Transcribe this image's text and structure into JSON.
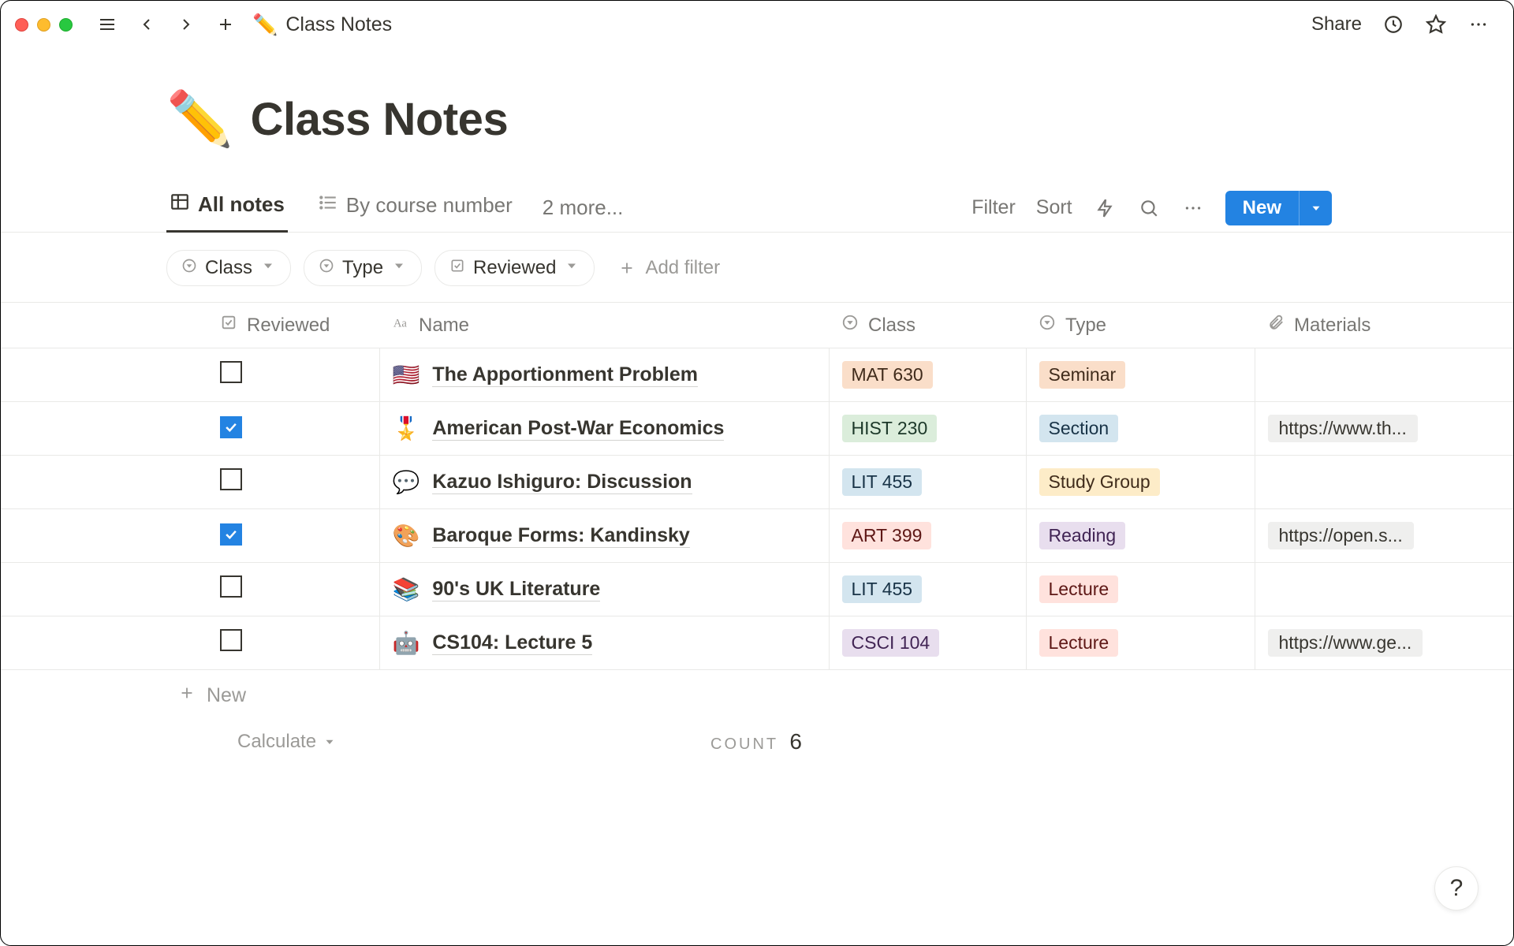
{
  "breadcrumb": {
    "emoji": "✏️",
    "title": "Class Notes"
  },
  "topbar": {
    "share_label": "Share"
  },
  "page": {
    "emoji": "✏️",
    "title": "Class Notes"
  },
  "views": {
    "tabs": [
      {
        "icon": "table",
        "label": "All notes",
        "active": true
      },
      {
        "icon": "list",
        "label": "By course number",
        "active": false
      }
    ],
    "more_label": "2 more...",
    "filter_label": "Filter",
    "sort_label": "Sort",
    "new_label": "New"
  },
  "filters": {
    "chips": [
      {
        "icon": "multiselect",
        "label": "Class"
      },
      {
        "icon": "multiselect",
        "label": "Type"
      },
      {
        "icon": "checkbox",
        "label": "Reviewed"
      }
    ],
    "add_label": "Add filter"
  },
  "columns": [
    {
      "icon": "checkbox",
      "label": "Reviewed"
    },
    {
      "icon": "text",
      "label": "Name"
    },
    {
      "icon": "multiselect",
      "label": "Class"
    },
    {
      "icon": "multiselect",
      "label": "Type"
    },
    {
      "icon": "attachment",
      "label": "Materials"
    }
  ],
  "rows": [
    {
      "reviewed": false,
      "emoji": "🇺🇸",
      "title": "The Apportionment Problem",
      "class": {
        "text": "MAT 630",
        "bg": "#fadec9",
        "fg": "#402b1b"
      },
      "type": {
        "text": "Seminar",
        "bg": "#fadec9",
        "fg": "#402b1b"
      },
      "material": ""
    },
    {
      "reviewed": true,
      "emoji": "🎖️",
      "title": "American Post-War Economics",
      "class": {
        "text": "HIST 230",
        "bg": "#dbeddb",
        "fg": "#1c3829"
      },
      "type": {
        "text": "Section",
        "bg": "#d3e5ef",
        "fg": "#183347"
      },
      "material": "https://www.th..."
    },
    {
      "reviewed": false,
      "emoji": "💬",
      "title": "Kazuo Ishiguro: Discussion",
      "class": {
        "text": "LIT 455",
        "bg": "#d3e5ef",
        "fg": "#183347"
      },
      "type": {
        "text": "Study Group",
        "bg": "#fdecc8",
        "fg": "#402c1b"
      },
      "material": ""
    },
    {
      "reviewed": true,
      "emoji": "🎨",
      "title": "Baroque Forms: Kandinsky",
      "class": {
        "text": "ART 399",
        "bg": "#ffe2dd",
        "fg": "#5d1715"
      },
      "type": {
        "text": "Reading",
        "bg": "#e8deee",
        "fg": "#412454"
      },
      "material": "https://open.s..."
    },
    {
      "reviewed": false,
      "emoji": "📚",
      "title": "90's UK Literature",
      "class": {
        "text": "LIT 455",
        "bg": "#d3e5ef",
        "fg": "#183347"
      },
      "type": {
        "text": "Lecture",
        "bg": "#ffe2dd",
        "fg": "#5d1715"
      },
      "material": ""
    },
    {
      "reviewed": false,
      "emoji": "🤖",
      "title": "CS104: Lecture 5",
      "class": {
        "text": "CSCI 104",
        "bg": "#e8deee",
        "fg": "#412454"
      },
      "type": {
        "text": "Lecture",
        "bg": "#ffe2dd",
        "fg": "#5d1715"
      },
      "material": "https://www.ge..."
    }
  ],
  "footer": {
    "new_label": "New",
    "calculate_label": "Calculate",
    "count_label": "COUNT",
    "count_value": "6"
  },
  "help": {
    "label": "?"
  }
}
